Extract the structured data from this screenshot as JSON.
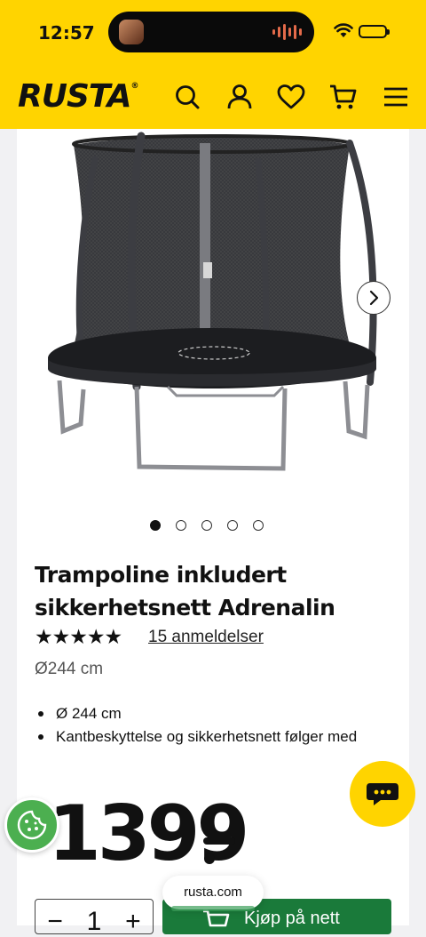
{
  "status_bar": {
    "time": "12:57"
  },
  "header": {
    "logo": "RUSTA",
    "icons": [
      "search-icon",
      "user-icon",
      "heart-icon",
      "cart-icon",
      "menu-icon"
    ]
  },
  "gallery": {
    "dot_count": 5,
    "active_dot": 0
  },
  "product": {
    "title": "Trampoline inkludert sikkerhetsnett Adrenalin",
    "rating_stars": "★★★★★",
    "rating": 5,
    "reviews_link": "15 anmeldelser",
    "size": "Ø244 cm",
    "bullets": [
      "Ø 244 cm",
      "Kantbeskyttelse og sikkerhetsnett følger med"
    ],
    "price": "1399"
  },
  "purchase": {
    "qty_minus": "−",
    "qty_value": "1",
    "qty_plus": "+",
    "buy_label": "Kjøp på nett"
  },
  "browser": {
    "url": "rusta.com"
  },
  "colors": {
    "brand_yellow": "#ffd400",
    "buy_green": "#1a7a3a",
    "cookie_green": "#4caf50"
  }
}
